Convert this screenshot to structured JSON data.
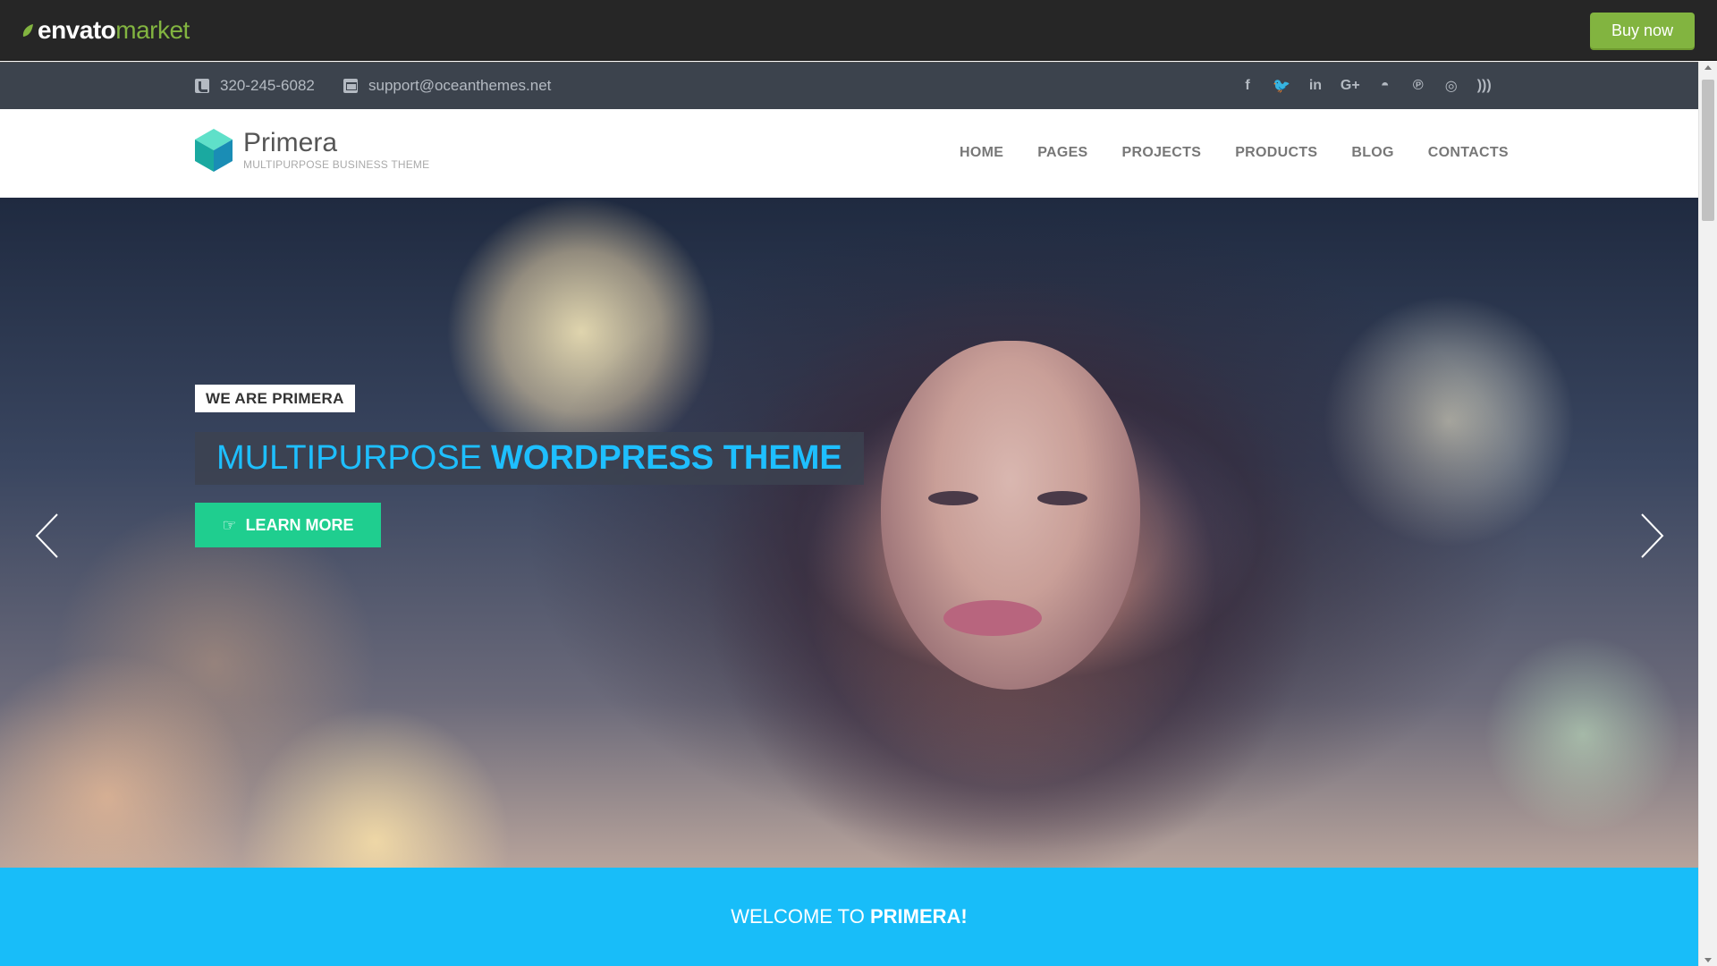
{
  "envato": {
    "logo_part1": "envato",
    "logo_part2": "market",
    "buy_label": "Buy now"
  },
  "topbar": {
    "phone": "320-245-6082",
    "email": "support@oceanthemes.net",
    "socials": [
      {
        "name": "facebook-icon",
        "glyph": "f"
      },
      {
        "name": "twitter-icon",
        "glyph": "🐦"
      },
      {
        "name": "linkedin-icon",
        "glyph": "in"
      },
      {
        "name": "google-plus-icon",
        "glyph": "G+"
      },
      {
        "name": "github-icon",
        "glyph": "◓"
      },
      {
        "name": "pinterest-icon",
        "glyph": "℗"
      },
      {
        "name": "instagram-icon",
        "glyph": "◎"
      },
      {
        "name": "rss-icon",
        "glyph": ")))"
      }
    ]
  },
  "brand": {
    "title": "Primera",
    "subtitle": "MULTIPURPOSE BUSINESS THEME"
  },
  "nav": {
    "items": [
      "HOME",
      "PAGES",
      "PROJECTS",
      "PRODUCTS",
      "BLOG",
      "CONTACTS"
    ]
  },
  "hero": {
    "badge": "WE ARE PRIMERA",
    "title_light": "MULTIPURPOSE",
    "title_bold": "WORDPRESS THEME",
    "button_label": "LEARN MORE"
  },
  "welcome": {
    "prefix": "WELCOME TO ",
    "brand": "PRIMERA!"
  },
  "colors": {
    "accent_blue": "#18bdf9",
    "accent_green": "#1fce8f",
    "envato_green": "#82b440",
    "topbar_bg": "#3c434d"
  }
}
